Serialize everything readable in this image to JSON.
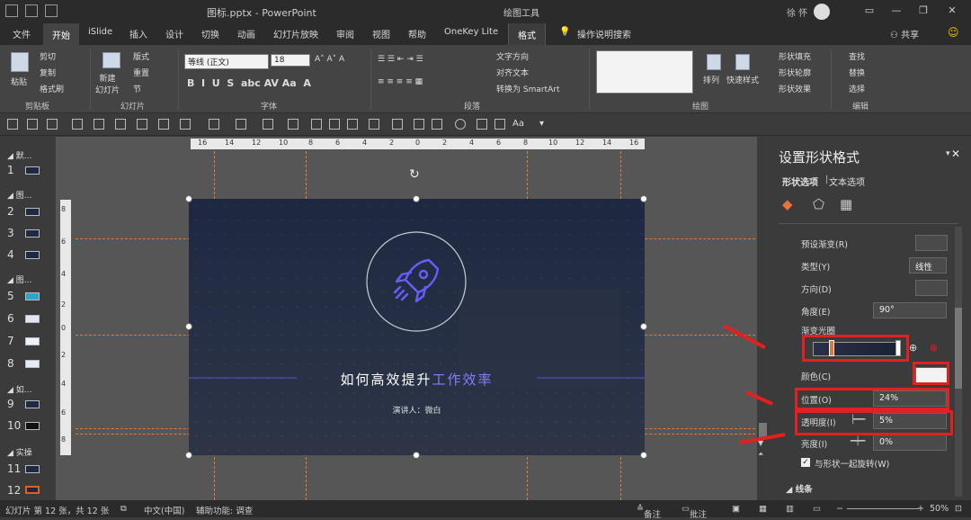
{
  "window": {
    "title": "图标.pptx - PowerPoint",
    "context_title": "绘图工具",
    "user": "徐 怀"
  },
  "tabs": [
    {
      "label": "文件"
    },
    {
      "label": "开始"
    },
    {
      "label": "iSlide"
    },
    {
      "label": "插入"
    },
    {
      "label": "设计"
    },
    {
      "label": "切换"
    },
    {
      "label": "动画"
    },
    {
      "label": "幻灯片放映"
    },
    {
      "label": "审阅"
    },
    {
      "label": "视图"
    },
    {
      "label": "帮助"
    },
    {
      "label": "OneKey Lite"
    },
    {
      "label": "格式"
    }
  ],
  "tell_me": "操作说明搜索",
  "share": "共享",
  "ribbon": {
    "clipboard": {
      "paste": "粘贴",
      "cut": "剪切",
      "copy": "复制",
      "format_painter": "格式刷",
      "label": "剪贴板"
    },
    "slides": {
      "new_slide": "新建\n幻灯片",
      "layout": "版式",
      "reset": "重置",
      "section": "节",
      "label": "幻灯片"
    },
    "font": {
      "name": "等线 (正文)",
      "size": "18",
      "label": "字体"
    },
    "paragraph": {
      "text_direction": "文字方向",
      "align_text": "对齐文本",
      "smartart": "转换为 SmartArt",
      "label": "段落"
    },
    "drawing": {
      "arrange": "排列",
      "quick_styles": "快速样式",
      "fill": "形状填充",
      "outline": "形状轮廓",
      "effects": "形状效果",
      "label": "绘图"
    },
    "editing": {
      "find": "查找",
      "replace": "替换",
      "select": "选择",
      "label": "编辑"
    }
  },
  "slide_panel": {
    "sections": [
      "默...",
      "图...",
      "图...",
      "如...",
      "实操"
    ],
    "numbers": [
      "1",
      "2",
      "3",
      "4",
      "5",
      "6",
      "7",
      "8",
      "9",
      "10",
      "11",
      "12"
    ]
  },
  "ruler": {
    "h": [
      "16",
      "14",
      "12",
      "10",
      "8",
      "6",
      "4",
      "2",
      "0",
      "2",
      "4",
      "6",
      "8",
      "10",
      "12",
      "14",
      "16"
    ],
    "v": [
      "8",
      "6",
      "4",
      "2",
      "0",
      "2",
      "4",
      "6",
      "8"
    ]
  },
  "slide": {
    "title_main": "如何高效提升",
    "title_highlight": "工作效率",
    "subtitle": "演讲人：微白",
    "accent": "#6a5cff"
  },
  "pane": {
    "title": "设置形状格式",
    "tab_shape": "形状选项",
    "tab_text": "文本选项",
    "rows": {
      "preset": "预设渐变(R)",
      "type": "类型(Y)",
      "type_value": "线性",
      "direction": "方向(D)",
      "angle": "角度(E)",
      "angle_value": "90°",
      "stops": "渐变光圈",
      "color": "颜色(C)",
      "position": "位置(O)",
      "position_value": "24%",
      "transparency": "透明度(I)",
      "transparency_value": "5%",
      "brightness": "亮度(I)",
      "brightness_value": "0%",
      "rotate_with_shape": "与形状一起旋转(W)",
      "next_section": "线条"
    }
  },
  "status": {
    "slide_info": "幻灯片 第 12 张，共 12 张",
    "language": "中文(中国)",
    "accessibility": "辅助功能: 调查",
    "notes": "备注",
    "comments": "批注",
    "zoom": "50%"
  }
}
